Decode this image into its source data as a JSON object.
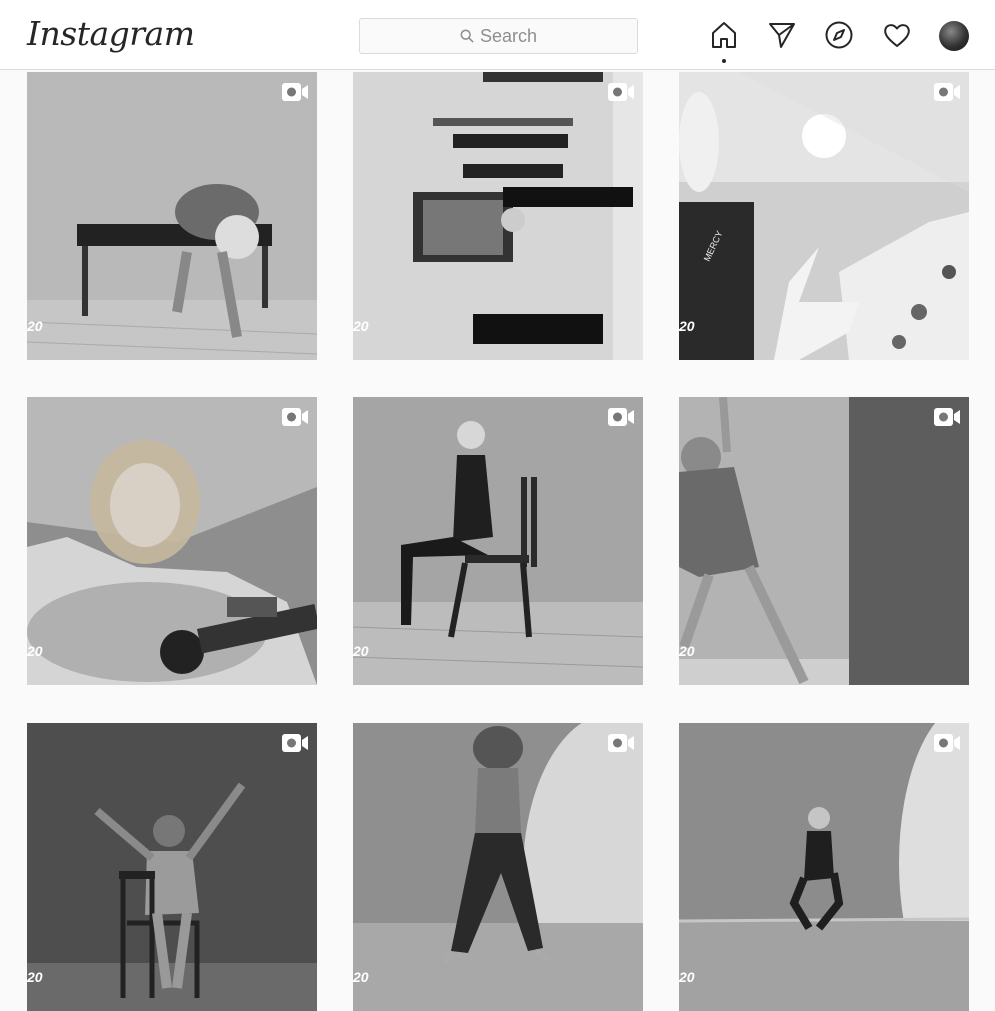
{
  "header": {
    "logo": "Instagram",
    "search_placeholder": "Search",
    "nav": [
      "home-icon",
      "direct-icon",
      "explore-icon",
      "activity-icon",
      "profile-avatar"
    ]
  },
  "posts": [
    {
      "type": "video",
      "side_text": "20"
    },
    {
      "type": "video",
      "side_text": "20"
    },
    {
      "type": "video",
      "side_text": "20"
    },
    {
      "type": "video",
      "side_text": "20"
    },
    {
      "type": "video",
      "side_text": "20"
    },
    {
      "type": "video",
      "side_text": "20"
    },
    {
      "type": "video",
      "side_text": "20"
    },
    {
      "type": "video",
      "side_text": "20"
    },
    {
      "type": "video",
      "side_text": "20"
    }
  ],
  "shirt_text": "MERCY"
}
